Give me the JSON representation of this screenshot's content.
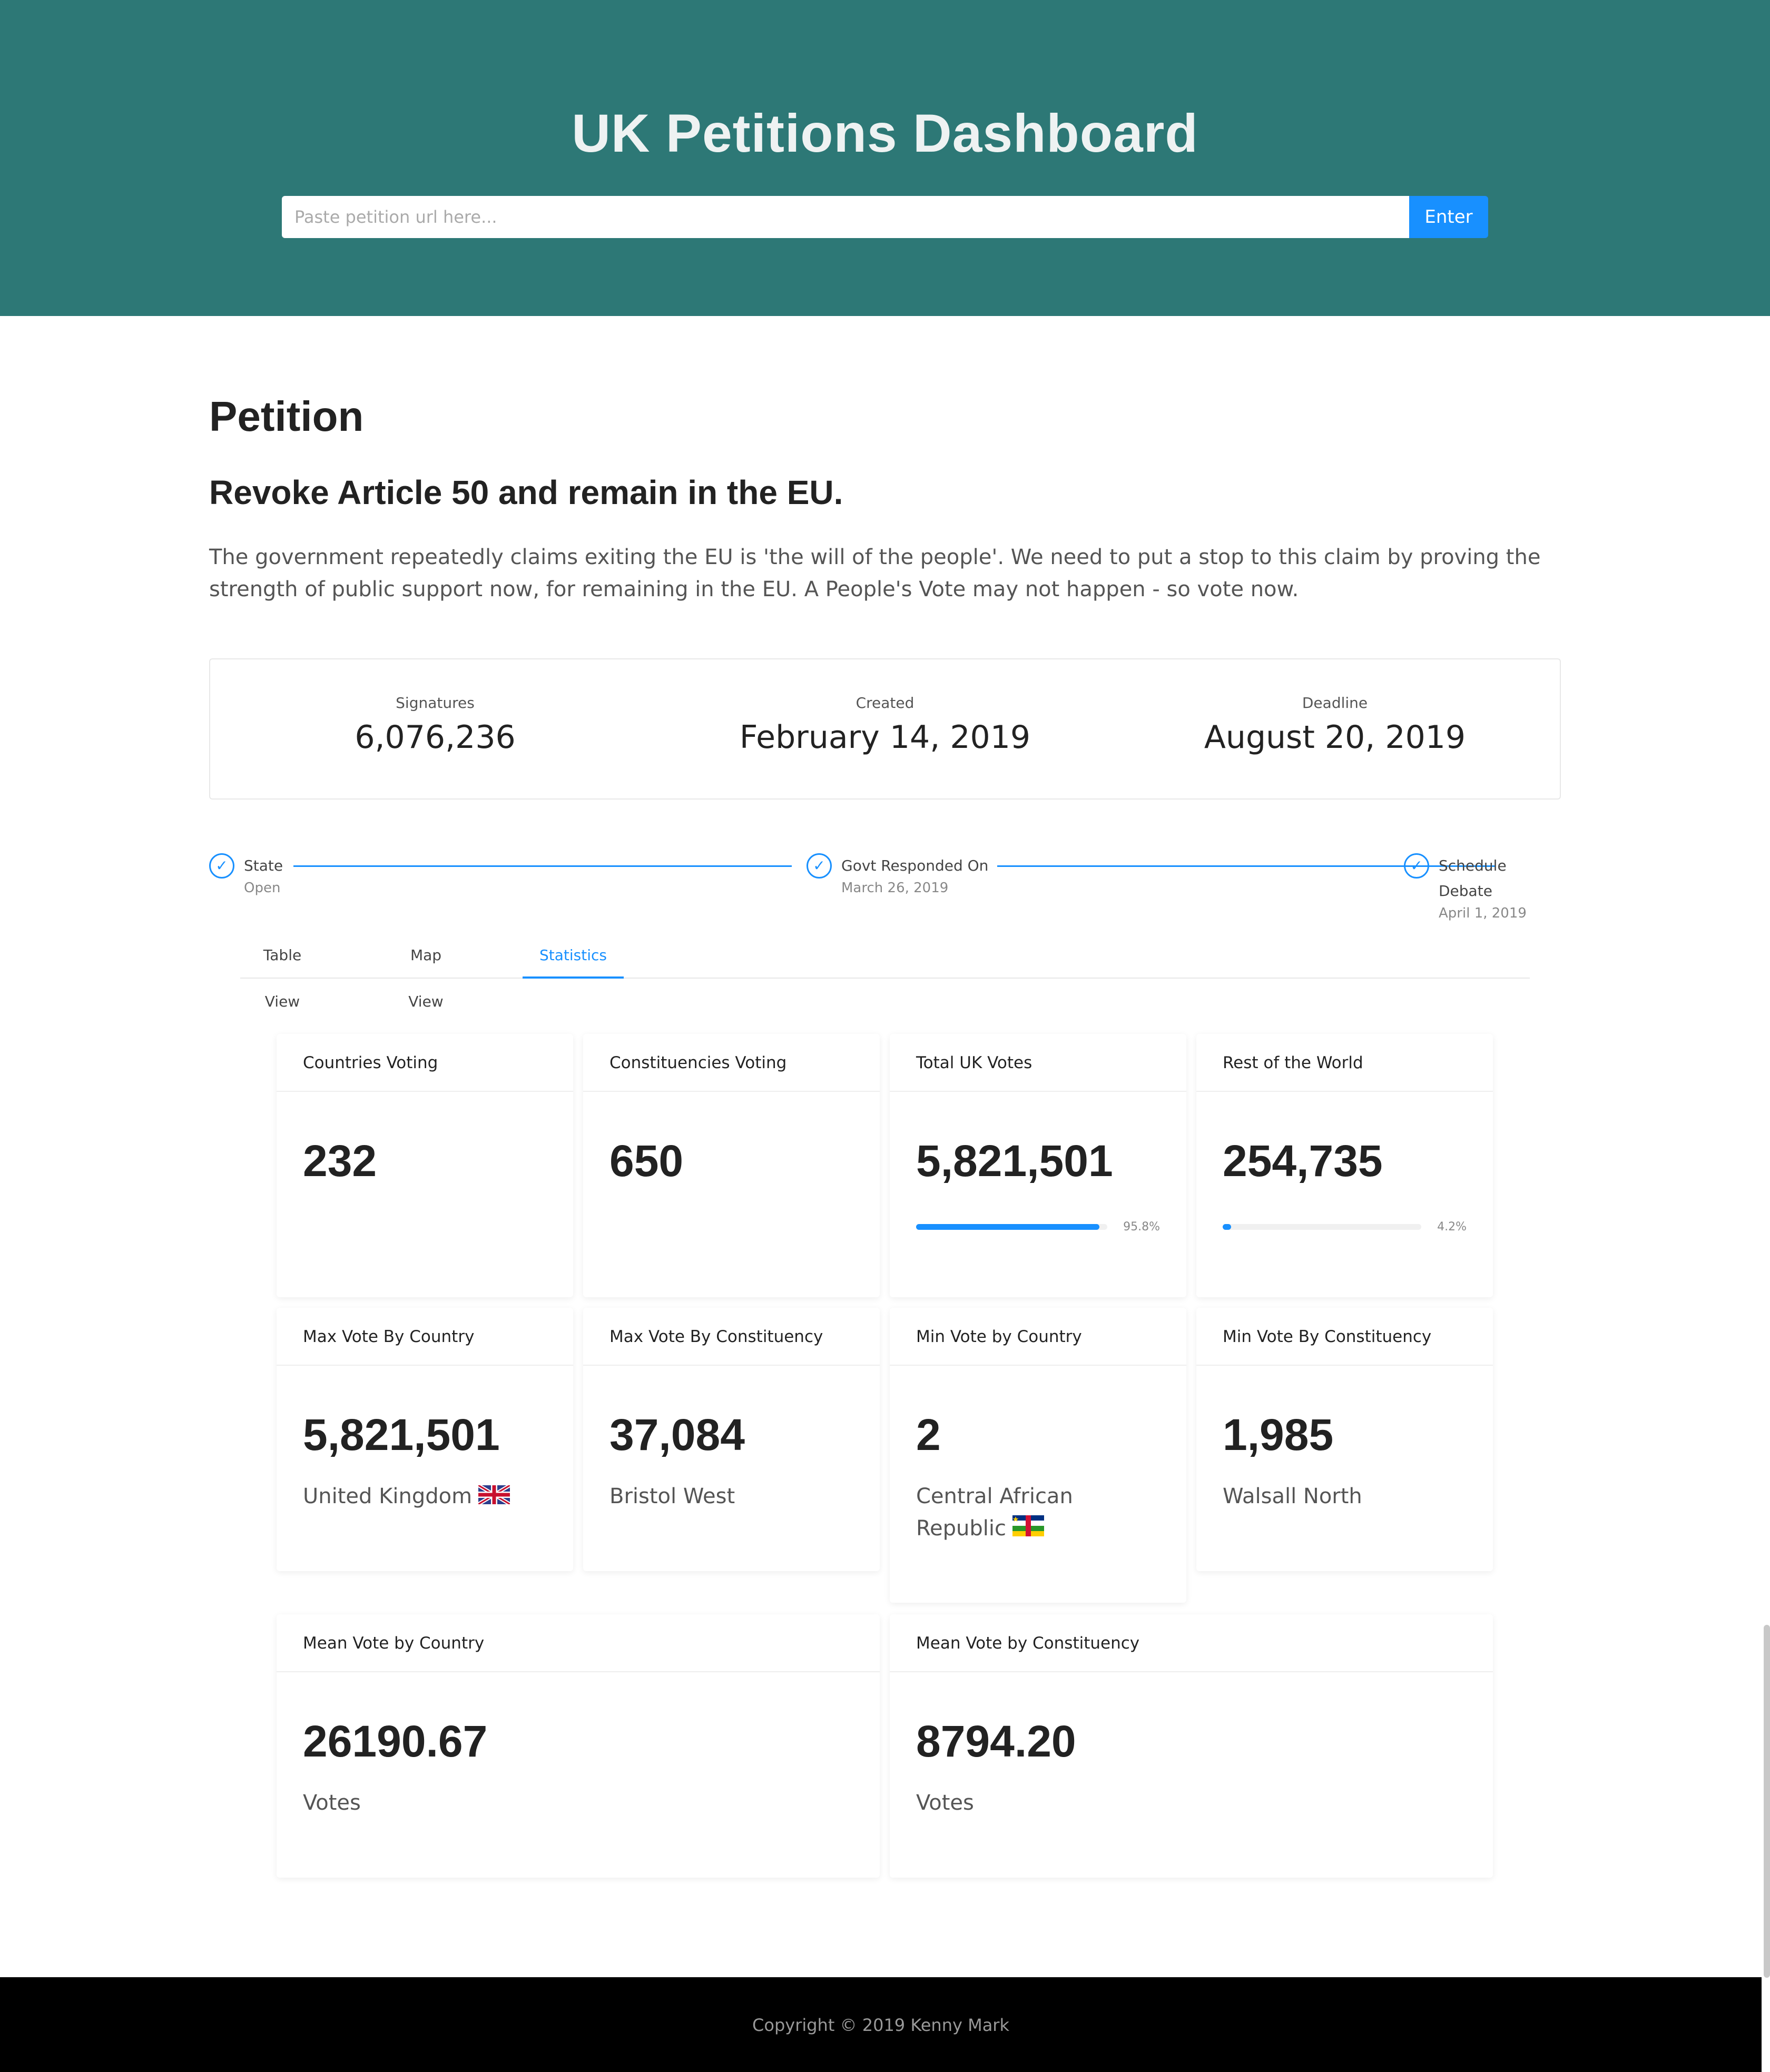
{
  "header": {
    "title": "UK Petitions Dashboard",
    "search_placeholder": "Paste petition url here...",
    "enter_label": "Enter"
  },
  "petition": {
    "section_title": "Petition",
    "name": "Revoke Article 50 and remain in the EU.",
    "description": "The government repeatedly claims exiting the EU is 'the will of the people'. We need to put a stop to this claim by proving the strength of public support now, for remaining in the EU. A People's Vote may not happen - so vote now."
  },
  "summary": {
    "signatures_label": "Signatures",
    "signatures_value": "6,076,236",
    "created_label": "Created",
    "created_value": "February 14, 2019",
    "deadline_label": "Deadline",
    "deadline_value": "August 20, 2019"
  },
  "steps": [
    {
      "title": "State",
      "desc": "Open"
    },
    {
      "title": "Govt Responded On",
      "desc": "March 26, 2019"
    },
    {
      "title": "Schedule Debate",
      "desc": "April 1, 2019"
    }
  ],
  "tabs": {
    "table_view": "Table View",
    "map_view": "Map View",
    "statistics": "Statistics",
    "active": "statistics"
  },
  "stats": {
    "countries_voting": {
      "label": "Countries Voting",
      "value": "232"
    },
    "constituencies_voting": {
      "label": "Constituencies Voting",
      "value": "650"
    },
    "total_uk_votes": {
      "label": "Total UK Votes",
      "value": "5,821,501",
      "percent_label": "95.8%",
      "fraction": 0.958
    },
    "rest_of_world": {
      "label": "Rest of the World",
      "value": "254,735",
      "percent_label": "4.2%",
      "fraction": 0.042
    },
    "max_vote_country": {
      "label": "Max Vote By Country",
      "value": "5,821,501",
      "sub": "United Kingdom",
      "flag": "uk-flag-icon"
    },
    "max_vote_constituency": {
      "label": "Max Vote By Constituency",
      "value": "37,084",
      "sub": "Bristol West"
    },
    "min_vote_country": {
      "label": "Min Vote by Country",
      "value": "2",
      "sub": "Central African Republic",
      "flag": "car-flag-icon"
    },
    "min_vote_constituency": {
      "label": "Min Vote By Constituency",
      "value": "1,985",
      "sub": "Walsall North"
    },
    "mean_vote_country": {
      "label": "Mean Vote by Country",
      "value": "26190.67",
      "sub": "Votes"
    },
    "mean_vote_constituency": {
      "label": "Mean Vote by Constituency",
      "value": "8794.20",
      "sub": "Votes"
    }
  },
  "footer": {
    "copyright": "Copyright © 2019 Kenny Mark"
  },
  "colors": {
    "header_bg": "#2d7876",
    "accent": "#1890ff",
    "footer_bg": "#000000"
  }
}
